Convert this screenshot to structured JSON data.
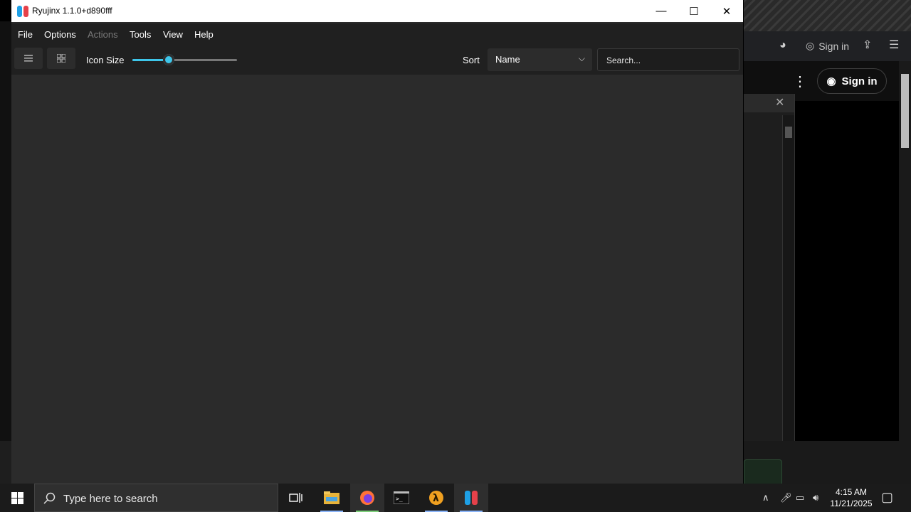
{
  "window": {
    "title": "Ryujinx 1.1.0+d890fff",
    "controls": {
      "minimize": "—",
      "maximize": "☐",
      "close": "✕"
    }
  },
  "menu": {
    "items": [
      {
        "label": "File",
        "enabled": true
      },
      {
        "label": "Options",
        "enabled": true
      },
      {
        "label": "Actions",
        "enabled": false
      },
      {
        "label": "Tools",
        "enabled": true
      },
      {
        "label": "View",
        "enabled": true
      },
      {
        "label": "Help",
        "enabled": true
      }
    ]
  },
  "toolbar": {
    "icon_size_label": "Icon Size",
    "icon_size_slider_fraction": 0.35,
    "sort_label": "Sort",
    "sort_value": "Name",
    "search_placeholder": "Search..."
  },
  "background": {
    "signin_small": "Sign in",
    "signin_button": "Sign in"
  },
  "taskbar": {
    "search_placeholder": "Type here to search",
    "apps": [
      "task-view-icon",
      "file-explorer-icon",
      "firefox-icon",
      "terminal-icon",
      "half-life-icon",
      "ryujinx-icon"
    ],
    "time": "4:15 AM",
    "date": "11/21/2025"
  },
  "colors": {
    "accent": "#3ec6ea",
    "window_bg": "#2b2b2b",
    "toolbar_bg": "#202020"
  }
}
